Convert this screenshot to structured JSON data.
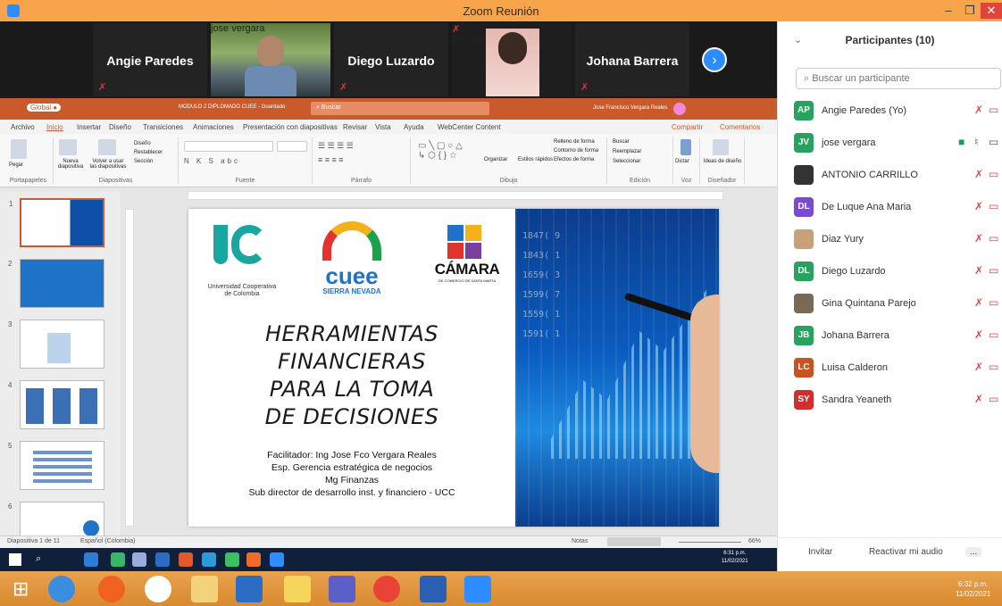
{
  "window": {
    "title": "Zoom Reunión",
    "icon": "zoom-icon",
    "min": "–",
    "max": "❐",
    "close": "✕"
  },
  "gallery": {
    "tiles": [
      {
        "name": "Angie Paredes"
      },
      {
        "label": "jose vergara"
      },
      {
        "name": "Diego Luzardo"
      },
      {
        "label": "Diaz Yury"
      },
      {
        "name": "Johana Barrera"
      }
    ],
    "next_icon": "chevron-right-icon"
  },
  "powerpoint": {
    "user": "Jose Francisco Vergara Reales",
    "file": "MODULO 2 DIPLOMADO CUEE - Guardado",
    "search": "Buscar",
    "tabs": [
      "Archivo",
      "Inicio",
      "Insertar",
      "Diseño",
      "Transiciones",
      "Animaciones",
      "Presentación con diapositivas",
      "Revisar",
      "Vista",
      "Ayuda",
      "WebCenter Content"
    ],
    "share": "Compartir",
    "comments": "Comentarios",
    "groups": [
      "Portapapeles",
      "Diapositivas",
      "Fuente",
      "Párrafo",
      "Dibujo",
      "Edición",
      "Voz",
      "Diseñador"
    ],
    "group_buttons": {
      "paste": "Pegar",
      "new_slide": "Nueva diapositiva",
      "reuse": "Volver a usar las diapositivas",
      "layout": "Diseño",
      "reset": "Restablecer",
      "section": "Sección",
      "organize": "Organizar",
      "quick_styles": "Estilos rápidos",
      "fill": "Relleno de forma",
      "outline": "Contorno de forma",
      "effects": "Efectos de forma",
      "find": "Buscar",
      "replace": "Reemplazar",
      "select": "Seleccionar",
      "dictate": "Dictar",
      "design_ideas": "Ideas de diseño"
    },
    "status_left": "Diapositiva 1 de 11",
    "status_lang": "Español (Colombia)",
    "status_notes": "Notas",
    "zoom": "66%",
    "thumbs": [
      "1",
      "2",
      "3",
      "4",
      "5",
      "6"
    ]
  },
  "slide": {
    "logo1_line1": "Universidad Cooperativa",
    "logo1_line2": "de Colombia",
    "logo2": "cuee",
    "logo2_sub": "SIERRA NEVADA",
    "logo3": "CÁMARA",
    "logo3_sub": "DE COMERCIO DE SANTA MARTA",
    "title_lines": [
      "HERRAMIENTAS",
      "FINANCIERAS",
      "PARA LA TOMA",
      "DE DECISIONES"
    ],
    "sub_lines": [
      "Facilitador: Ing Jose Fco Vergara Reales",
      "Esp. Gerencia estratégica de negocios",
      "Mg Finanzas",
      "Sub director de desarrollo inst. y financiero - UCC"
    ]
  },
  "inner_taskbar": {
    "time": "6:31 p.m.",
    "date": "11/02/2021"
  },
  "taskbar": {
    "time": "6:32 p.m.",
    "date": "11/02/2021"
  },
  "panel": {
    "title": "Participantes (10)",
    "search_placeholder": "Buscar un participante",
    "participants": [
      {
        "initials": "AP",
        "name": "Angie Paredes (Yo)",
        "color": "#27a35f"
      },
      {
        "initials": "JV",
        "name": "jose vergara",
        "color": "#27a35f"
      },
      {
        "initials": "",
        "name": "ANTONIO CARRILLO",
        "color": "#333333"
      },
      {
        "initials": "DL",
        "name": "De Luque Ana Maria",
        "color": "#7a4bd1"
      },
      {
        "initials": "",
        "name": "Diaz Yury",
        "color": "#c8a07a"
      },
      {
        "initials": "DL",
        "name": "Diego Luzardo",
        "color": "#27a35f"
      },
      {
        "initials": "",
        "name": "Gina Quintana Parejo",
        "color": "#7a6a55"
      },
      {
        "initials": "JB",
        "name": "Johana Barrera",
        "color": "#27a35f"
      },
      {
        "initials": "LC",
        "name": "Luisa Calderon",
        "color": "#c9531f"
      },
      {
        "initials": "SY",
        "name": "Sandra Yeaneth",
        "color": "#d12f2f"
      }
    ],
    "invite": "Invitar",
    "unmute": "Reactivar mi audio",
    "more": "..."
  }
}
